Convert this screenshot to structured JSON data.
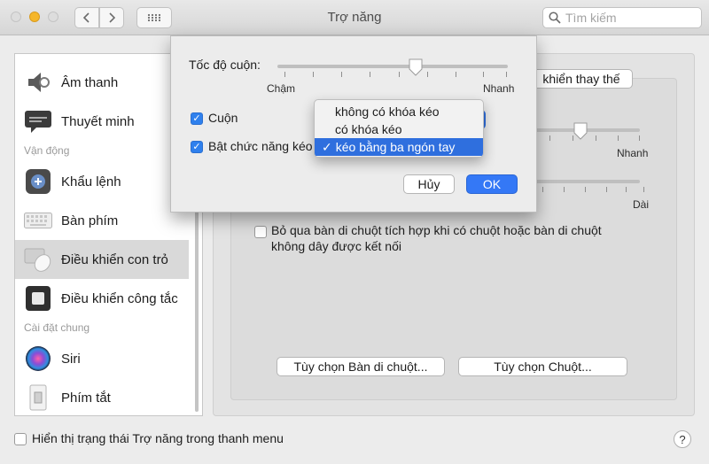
{
  "window": {
    "title": "Trợ năng"
  },
  "search": {
    "placeholder": "Tìm kiếm"
  },
  "sidebar": {
    "items": [
      {
        "label": "Âm thanh",
        "icon": "speaker-icon"
      },
      {
        "label": "Thuyết minh",
        "icon": "speech-bubble-icon"
      },
      {
        "label": "Khẩu lệnh",
        "icon": "voice-control-icon"
      },
      {
        "label": "Bàn phím",
        "icon": "keyboard-icon"
      },
      {
        "label": "Điều khiển con trỏ",
        "icon": "mouse-trackpad-icon"
      },
      {
        "label": "Điều khiển công tắc",
        "icon": "switch-control-icon"
      },
      {
        "label": "Siri",
        "icon": "siri-icon"
      },
      {
        "label": "Phím tắt",
        "icon": "shortcut-switch-icon"
      }
    ],
    "sections": {
      "motor": "Vận động",
      "general": "Cài đặt chung"
    },
    "selected_index": 4
  },
  "main": {
    "alt_control_button": "khiển thay thế",
    "speed_right_label": "Nhanh",
    "delay_right_label": "Dài",
    "ignore_trackpad_line1": "Bỏ qua bàn di chuột tích hợp khi có chuột hoặc bàn di chuột",
    "ignore_trackpad_line2": "không dây được kết nối",
    "trackpad_options_button": "Tùy chọn Bàn di chuột...",
    "mouse_options_button": "Tùy chọn Chuột..."
  },
  "sheet": {
    "scroll_speed_label": "Tốc độ cuộn:",
    "slow_label": "Chậm",
    "fast_label": "Nhanh",
    "scroll_checkbox_label": "Cuộn",
    "drag_checkbox_label": "Bật chức năng kéo",
    "cancel_button": "Hủy",
    "ok_button": "OK",
    "scroll_speed_value": 0.6
  },
  "dropdown": {
    "options": [
      "không có khóa kéo",
      "có khóa kéo",
      "kéo bằng ba ngón tay"
    ],
    "selected": "kéo bằng ba ngón tay",
    "check": "✓"
  },
  "footer": {
    "show_status_label": "Hiển thị trạng thái Trợ năng trong thanh menu",
    "help": "?"
  },
  "colors": {
    "accent": "#2f6fde",
    "check_blue": "#2f80ed"
  }
}
